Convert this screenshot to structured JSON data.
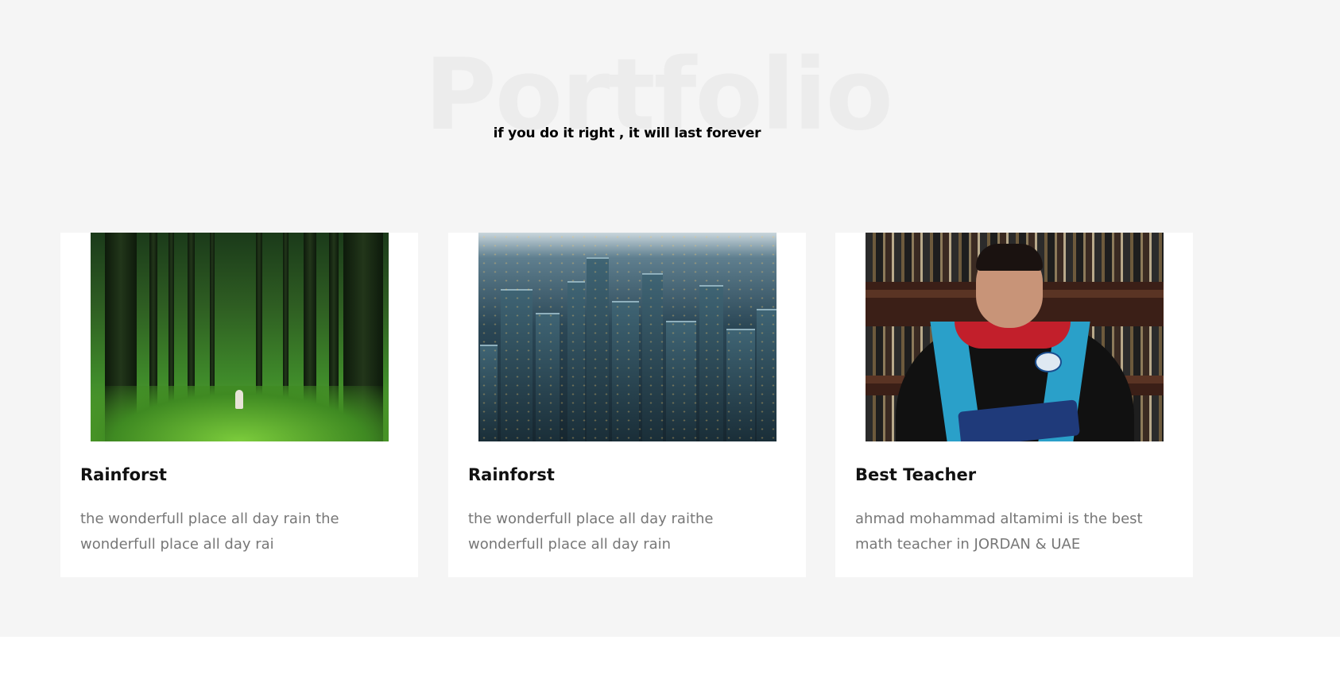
{
  "section": {
    "heading": "Portfolio",
    "subtitle": "if you do it right , it will last forever"
  },
  "cards": [
    {
      "image": "forest-photo",
      "title": "Rainforst",
      "text": "the wonderfull place all day rain the wonderfull place all day rai"
    },
    {
      "image": "city-photo",
      "title": "Rainforst",
      "text": "the wonderfull place all day raithe wonderfull place all day rain"
    },
    {
      "image": "graduate-teacher-photo",
      "title": "Best Teacher",
      "text": "ahmad mohammad altamimi is the best math teacher in JORDAN & UAE"
    }
  ],
  "colors": {
    "section_background": "#f5f5f5",
    "card_background": "#ffffff",
    "heading_watermark": "#ececec",
    "title": "#111111",
    "body_text": "#777777"
  }
}
